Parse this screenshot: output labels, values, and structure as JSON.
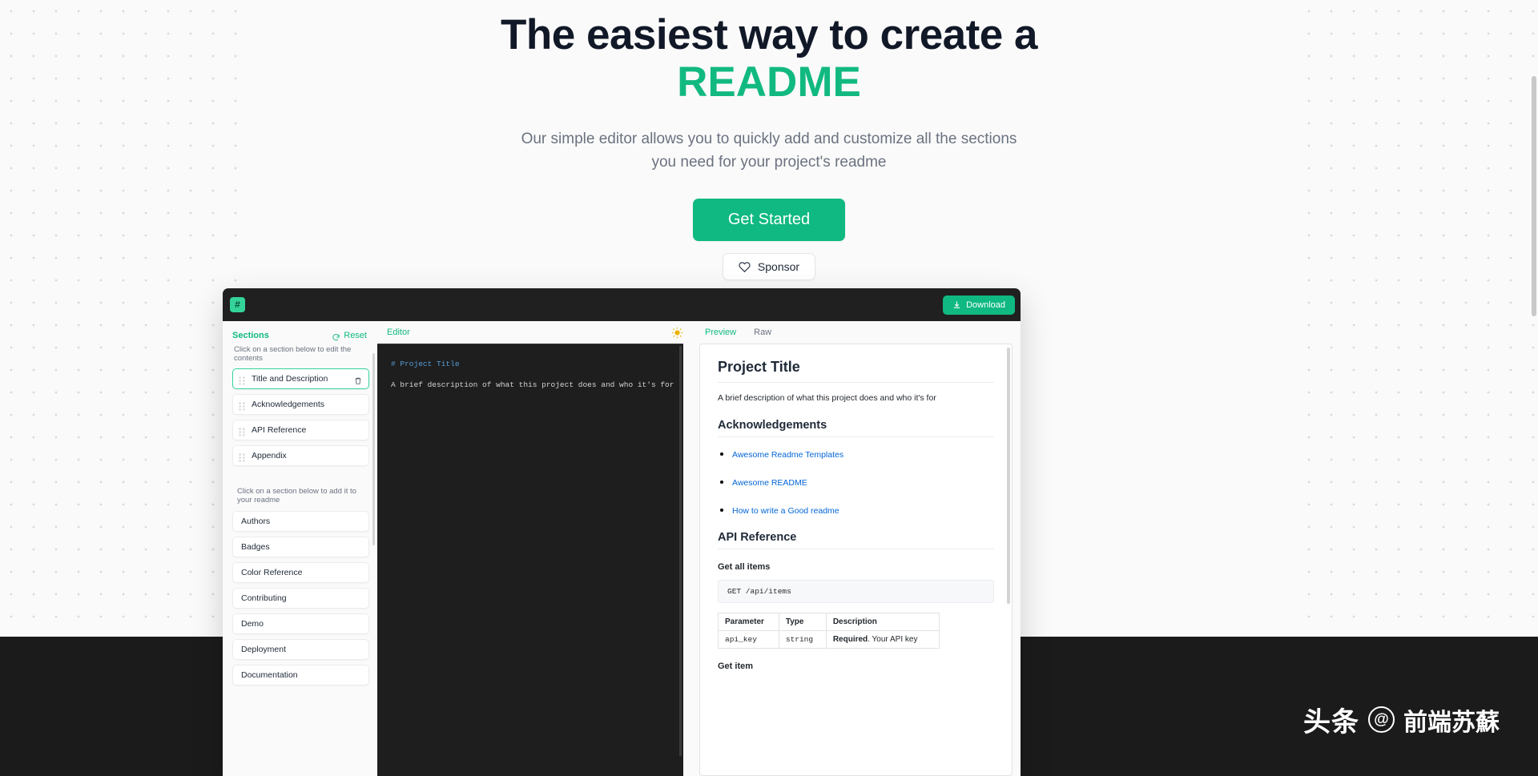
{
  "hero": {
    "title_line1": "The easiest way to create a",
    "title_brand": "README",
    "subtitle": "Our simple editor allows you to quickly add and customize all the sections you need for your project's readme",
    "get_started_label": "Get Started",
    "sponsor_label": "Sponsor",
    "brand_color": "#10b981"
  },
  "app": {
    "logo_glyph": "#",
    "download_label": "Download"
  },
  "sidebar": {
    "title": "Sections",
    "reset_label": "Reset",
    "hint_edit": "Click on a section below to edit the contents",
    "hint_add": "Click on a section below to add it to your readme",
    "active_sections": [
      {
        "label": "Title and Description"
      },
      {
        "label": "Acknowledgements"
      },
      {
        "label": "API Reference"
      },
      {
        "label": "Appendix"
      }
    ],
    "available_sections": [
      {
        "label": "Authors"
      },
      {
        "label": "Badges"
      },
      {
        "label": "Color Reference"
      },
      {
        "label": "Contributing"
      },
      {
        "label": "Demo"
      },
      {
        "label": "Deployment"
      },
      {
        "label": "Documentation"
      }
    ]
  },
  "editor": {
    "label": "Editor",
    "theme_toggle": "sun-icon",
    "code_heading": "# Project Title",
    "code_body": "A brief description of what this project does and who it's for"
  },
  "preview": {
    "tabs": [
      {
        "label": "Preview",
        "active": true
      },
      {
        "label": "Raw",
        "active": false
      }
    ],
    "title": "Project Title",
    "description": "A brief description of what this project does and who it's for",
    "acknowledgements_heading": "Acknowledgements",
    "acknowledgement_links": [
      {
        "label": "Awesome Readme Templates"
      },
      {
        "label": "Awesome README"
      },
      {
        "label": "How to write a Good readme"
      }
    ],
    "api_heading": "API Reference",
    "api_get_all_items": "Get all items",
    "api_code": "GET /api/items",
    "table_headers": [
      "Parameter",
      "Type",
      "Description"
    ],
    "table_rows": [
      {
        "parameter": "api_key",
        "type": "string",
        "desc_bold": "Required",
        "desc_rest": ". Your API key"
      }
    ],
    "api_get_item": "Get item"
  },
  "watermark": {
    "logo_text": "头条",
    "at_symbol": "@",
    "handle": "前端苏蘇"
  }
}
